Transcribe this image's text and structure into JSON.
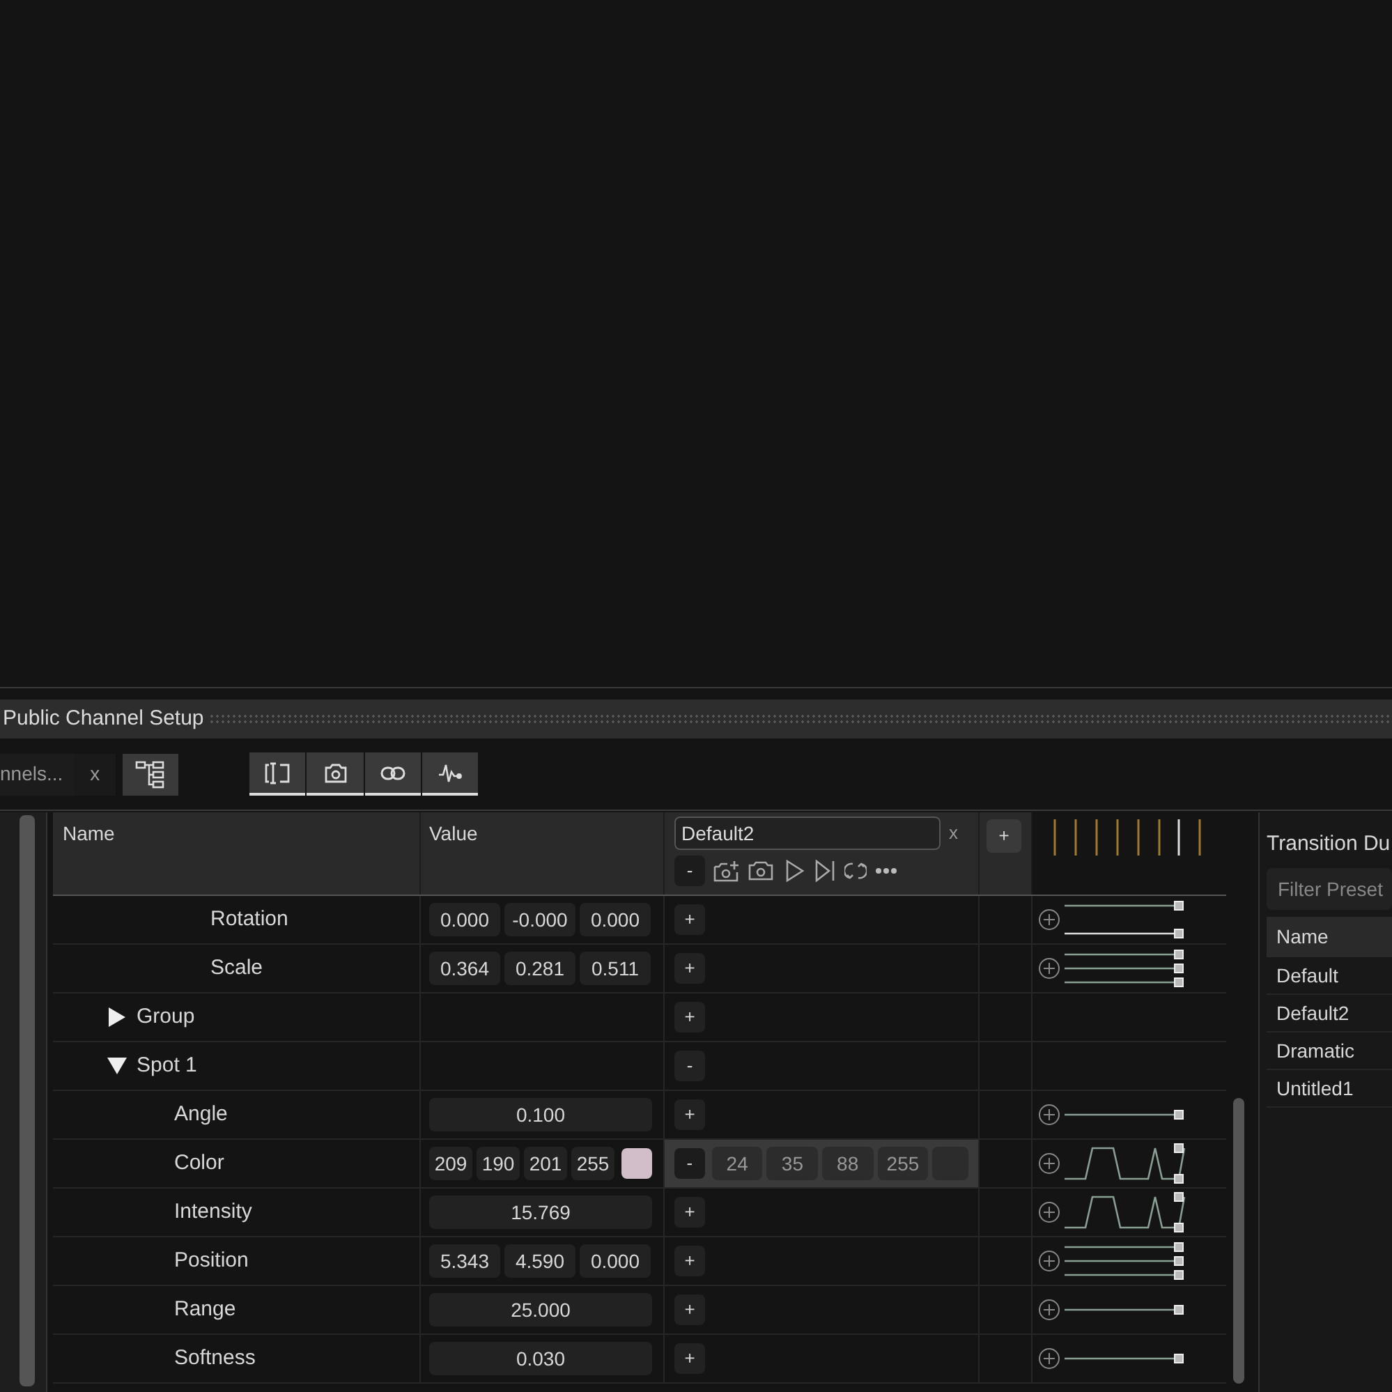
{
  "panel": {
    "title": "Public Channel Setup"
  },
  "toolbar": {
    "tab": {
      "label": "nnels...",
      "close": "x"
    }
  },
  "table": {
    "columns": [
      "Name",
      "Value"
    ],
    "preset": {
      "name": "Default2",
      "close": "x",
      "remove": "-",
      "add": "+"
    },
    "rows": [
      {
        "children": [
          {
            "children": [
              {
                "name": "Rotation",
                "kind": "vector",
                "values": [
                  "0.000",
                  "-0.000",
                  "0.000"
                ],
                "preset_button": "+",
                "selected": false,
                "curve": {
                  "kind": "double"
                }
              },
              {
                "name": "Scale",
                "kind": "vector",
                "values": [
                  "0.364",
                  "0.281",
                  "0.511"
                ],
                "preset_button": "+",
                "selected": false,
                "curve": {
                  "kind": "triple"
                }
              }
            ]
          }
        ]
      },
      {
        "name": "Group",
        "expanded": false,
        "preset_button": "+",
        "selected": false,
        "children": []
      },
      {
        "name": "Spot 1",
        "expanded": true,
        "preset_button": "-",
        "selected": false,
        "children": [
          {
            "name": "Angle",
            "kind": "scalar",
            "values": [
              "0.100"
            ],
            "preset_button": "+",
            "selected": false,
            "curve": {
              "kind": "single"
            }
          },
          {
            "name": "Color",
            "kind": "color",
            "values": [
              "209",
              "190",
              "201",
              "255"
            ],
            "color": "#d1bec9",
            "preset_button": "-",
            "selected": true,
            "preset_values": [
              "24",
              "35",
              "88",
              "255"
            ],
            "curve": {
              "kind": "pulse"
            }
          },
          {
            "name": "Intensity",
            "kind": "scalar",
            "values": [
              "15.769"
            ],
            "preset_button": "+",
            "selected": false,
            "curve": {
              "kind": "pulse"
            }
          },
          {
            "name": "Position",
            "kind": "vector",
            "values": [
              "5.343",
              "4.590",
              "0.000"
            ],
            "preset_button": "+",
            "selected": false,
            "curve": {
              "kind": "triple"
            }
          },
          {
            "name": "Range",
            "kind": "scalar",
            "values": [
              "25.000"
            ],
            "preset_button": "+",
            "selected": false,
            "curve": {
              "kind": "single"
            }
          },
          {
            "name": "Softness",
            "kind": "scalar",
            "values": [
              "0.030"
            ],
            "preset_button": "+",
            "selected": false,
            "curve": {
              "kind": "single"
            }
          }
        ]
      }
    ]
  },
  "presets": {
    "title": "Transition Du",
    "filter": {
      "placeholder": "Filter Preset"
    },
    "column": "Name",
    "items": [
      "Default",
      "Default2",
      "Dramatic",
      "Untitled1"
    ]
  }
}
